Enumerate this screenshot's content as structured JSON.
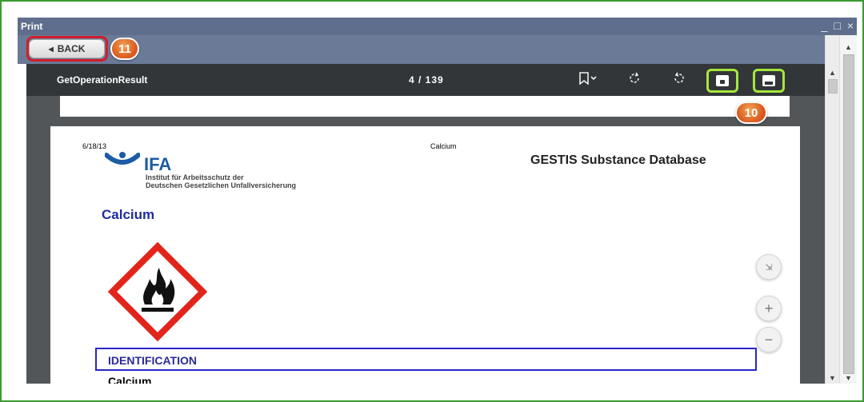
{
  "window": {
    "title": "Print",
    "controls": [
      "_",
      "□",
      "×"
    ]
  },
  "toolbar": {
    "back_label": "BACK",
    "back_icon": "triangle-left-icon"
  },
  "badges": {
    "back": "11",
    "print": "10"
  },
  "viewer": {
    "doc_title": "GetOperationResult",
    "page_current": "4",
    "page_total": "139",
    "page_counter": "4 / 139",
    "icons": [
      "bookmark-icon",
      "rotate-cw-icon",
      "rotate-ccw-icon",
      "save-icon",
      "print-icon"
    ]
  },
  "page": {
    "date": "6/18/13",
    "topic": "Calcium",
    "org_short": "IFA",
    "org_line1": "Institut für Arbeitsschutz der",
    "org_line2": "Deutschen Gesetzlichen Unfallversicherung",
    "db_title": "GESTIS Substance Database",
    "substance": "Calcium",
    "section": "IDENTIFICATION",
    "section_name": "Calcium"
  },
  "zoom": {
    "fit": "⇲",
    "in": "+",
    "out": "−"
  },
  "colors": {
    "highlight_back": "#d21d2a",
    "highlight_tools": "#a6e63c",
    "frame": "#3a9a2e",
    "badge": "#e0652a"
  }
}
